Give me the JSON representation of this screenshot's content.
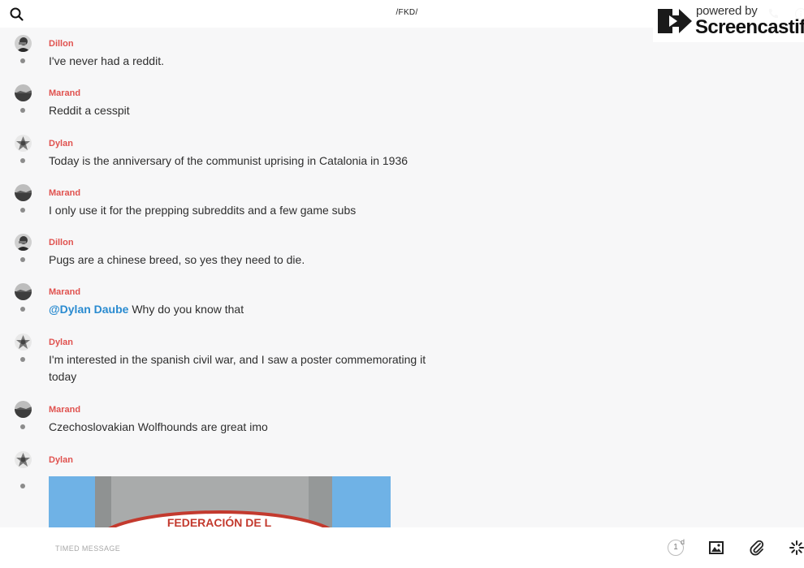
{
  "header": {
    "title": "/FKD/"
  },
  "watermark": {
    "powered": "powered by",
    "brand": "Screencastify"
  },
  "messages": [
    {
      "author": "Dillon",
      "text": "I've never had a reddit."
    },
    {
      "author": "Marand",
      "text": "Reddit a cesspit"
    },
    {
      "author": "Dylan",
      "text": "Today is the anniversary of the communist uprising in Catalonia in 1936"
    },
    {
      "author": "Marand",
      "text": "I only use it for the prepping subreddits and a few game subs"
    },
    {
      "author": "Dillon",
      "text": "Pugs are a chinese breed, so yes they need to die."
    },
    {
      "author": "Marand",
      "mention": "@Dylan Daube",
      "text": " Why do you know that"
    },
    {
      "author": "Dylan",
      "text": "I'm interested in the spanish civil war, and I saw a poster commemorating it today"
    },
    {
      "author": "Marand",
      "text": "Czechoslovakian Wolfhounds are great imo"
    },
    {
      "author": "Dylan",
      "text": ""
    }
  ],
  "photo": {
    "sign_text": "FEDERACIÓN DE L"
  },
  "composer": {
    "placeholder": "TIMED MESSAGE",
    "timer_value": "1",
    "timer_unit": "d"
  },
  "colors": {
    "author": "#e0524f",
    "mention": "#2a8bd0",
    "background": "#f7f7f8"
  }
}
